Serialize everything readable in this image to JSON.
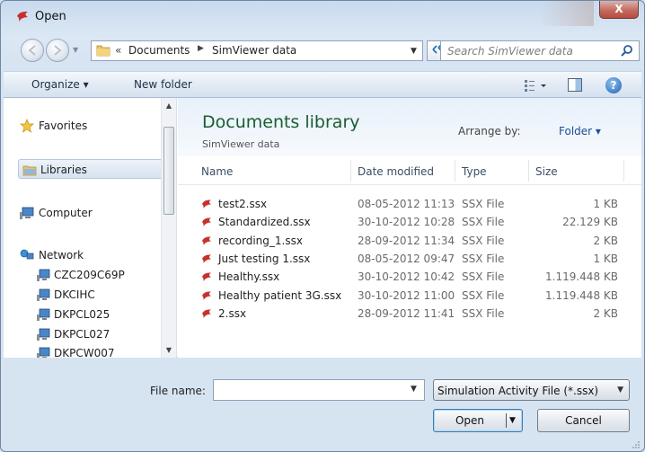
{
  "window": {
    "title": "Open",
    "close_label": "X"
  },
  "address_bar": {
    "overflow_chevron": "«",
    "crumb_separator": "▶",
    "breadcrumbs": [
      "Documents",
      "SimViewer data"
    ],
    "search_placeholder": "Search SimViewer data"
  },
  "toolbar": {
    "organize_label": "Organize ▾",
    "new_folder_label": "New folder",
    "help_label": "?"
  },
  "nav_pane": {
    "favorites": "Favorites",
    "libraries": "Libraries",
    "computer": "Computer",
    "network": "Network",
    "network_items": [
      "CZC209C69P",
      "DKCIHC",
      "DKPCL025",
      "DKPCL027",
      "DKPCW007"
    ]
  },
  "file_pane": {
    "library_title": "Documents library",
    "library_subtitle": "SimViewer data",
    "arrange_by_label": "Arrange by:",
    "arrange_by_value": "Folder ▾",
    "columns": {
      "name": "Name",
      "date": "Date modified",
      "type": "Type",
      "size": "Size"
    },
    "files": [
      {
        "name": "test2.ssx",
        "date": "08-05-2012 11:13",
        "type": "SSX File",
        "size": "1 KB"
      },
      {
        "name": "Standardized.ssx",
        "date": "30-10-2012 10:28",
        "type": "SSX File",
        "size": "22.129 KB"
      },
      {
        "name": "recording_1.ssx",
        "date": "28-09-2012 11:34",
        "type": "SSX File",
        "size": "2 KB"
      },
      {
        "name": "Just testing 1.ssx",
        "date": "08-05-2012 09:47",
        "type": "SSX File",
        "size": "1 KB"
      },
      {
        "name": "Healthy.ssx",
        "date": "30-10-2012 10:42",
        "type": "SSX File",
        "size": "1.119.448 KB"
      },
      {
        "name": "Healthy patient 3G.ssx",
        "date": "30-10-2012 11:00",
        "type": "SSX File",
        "size": "1.119.448 KB"
      },
      {
        "name": "2.ssx",
        "date": "28-09-2012 11:41",
        "type": "SSX File",
        "size": "2 KB"
      }
    ]
  },
  "bottom": {
    "file_name_label": "File name:",
    "file_name_value": "",
    "file_type_filter": "Simulation Activity File (*.ssx)",
    "open_label": "Open",
    "cancel_label": "Cancel"
  },
  "icons": {
    "app": "simviewer-app-icon",
    "back": "back-arrow-icon",
    "forward": "forward-arrow-icon",
    "folder": "folder-icon",
    "refresh": "refresh-icon",
    "search": "search-icon",
    "views": "views-icon",
    "preview": "preview-pane-icon",
    "help": "help-icon",
    "favorites": "star-icon",
    "libraries": "library-icon",
    "computer": "computer-icon",
    "network": "network-icon",
    "network_pc": "network-computer-icon",
    "file": "ssx-file-icon"
  },
  "colors": {
    "library_title": "#1a5d32",
    "link_blue": "#1b4f96",
    "frame": "#d6e3f1"
  }
}
